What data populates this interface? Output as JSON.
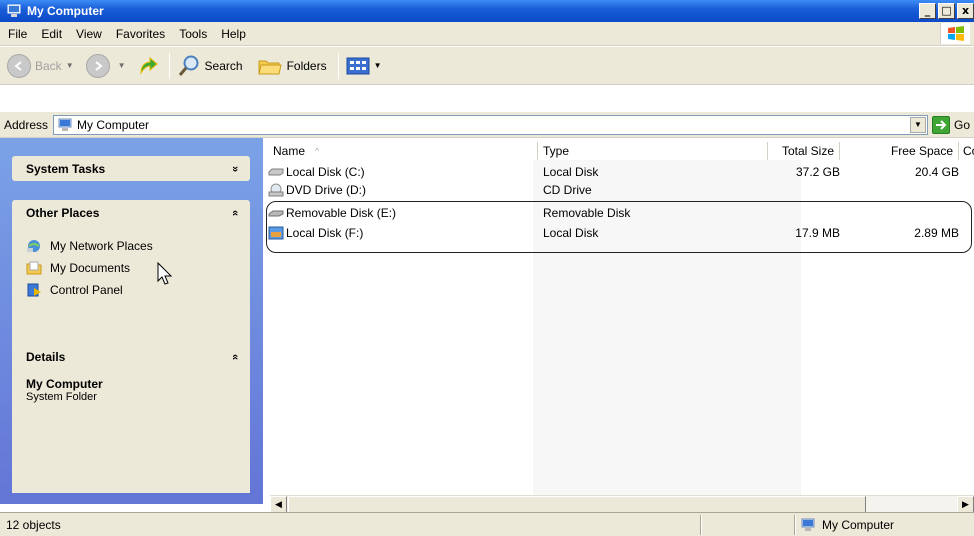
{
  "window": {
    "title": "My Computer",
    "controls": {
      "minimize": "_",
      "maximize": "□",
      "close": "x"
    }
  },
  "menubar": {
    "items": [
      "File",
      "Edit",
      "View",
      "Favorites",
      "Tools",
      "Help"
    ]
  },
  "toolbar": {
    "back_label": "Back",
    "search_label": "Search",
    "folders_label": "Folders"
  },
  "address": {
    "label": "Address",
    "value": "My Computer",
    "go_label": "Go"
  },
  "taskpane": {
    "system_tasks": {
      "title": "System Tasks",
      "chevron": "»"
    },
    "other_places": {
      "title": "Other Places",
      "chevron": "«",
      "items": [
        "My Network Places",
        "My Documents",
        "Control Panel"
      ]
    },
    "details": {
      "title": "Details",
      "chevron": "«",
      "name": "My Computer",
      "type": "System Folder"
    }
  },
  "list": {
    "columns": [
      "Name",
      "Type",
      "Total Size",
      "Free Space",
      "Co"
    ],
    "sort_indicator": "^",
    "rows": [
      {
        "name": "Local Disk (C:)",
        "type": "Local Disk",
        "total": "37.2 GB",
        "free": "20.4 GB",
        "icon": "hard-disk-icon"
      },
      {
        "name": "DVD Drive (D:)",
        "type": "CD Drive",
        "total": "",
        "free": "",
        "icon": "dvd-drive-icon"
      },
      {
        "name": "Removable Disk (E:)",
        "type": "Removable Disk",
        "total": "",
        "free": "",
        "icon": "removable-disk-icon"
      },
      {
        "name": "Local Disk (F:)",
        "type": "Local Disk",
        "total": "17.9 MB",
        "free": "2.89 MB",
        "icon": "local-disk-f-icon"
      }
    ]
  },
  "statusbar": {
    "objects": "12 objects",
    "location": "My Computer"
  }
}
